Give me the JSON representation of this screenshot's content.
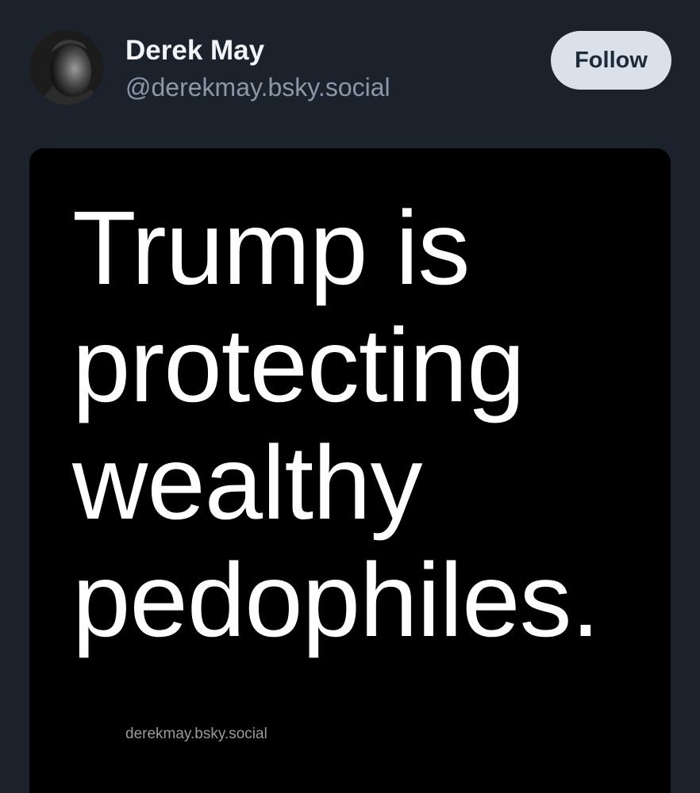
{
  "post": {
    "author": {
      "display_name": "Derek May",
      "handle": "@derekmay.bsky.social"
    },
    "follow_label": "Follow",
    "image": {
      "lines": [
        "Trump is",
        "protecting",
        "wealthy",
        "pedophiles."
      ],
      "watermark": "derekmay.bsky.social"
    }
  },
  "colors": {
    "background": "#1b222c",
    "follow_button_bg": "#dbe1ea",
    "handle_text": "#8a98aa",
    "image_bg": "#000000"
  }
}
